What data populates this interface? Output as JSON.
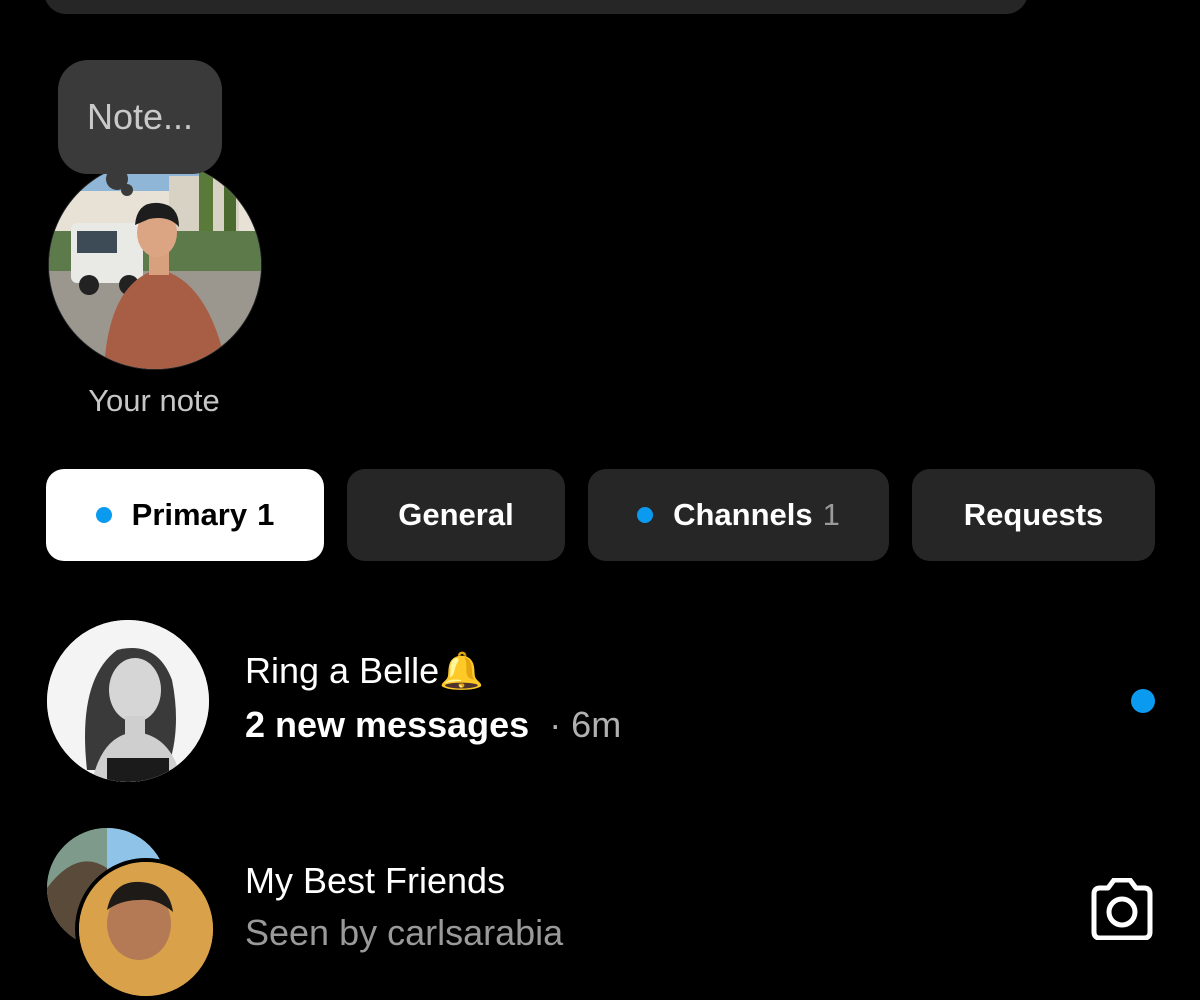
{
  "note": {
    "placeholder": "Note...",
    "caption": "Your note"
  },
  "tabs": [
    {
      "label": "Primary",
      "count": "1",
      "active": true,
      "unread_dot": true
    },
    {
      "label": "General",
      "count": "",
      "active": false,
      "unread_dot": false
    },
    {
      "label": "Channels",
      "count": "1",
      "active": false,
      "unread_dot": true
    },
    {
      "label": "Requests",
      "count": "",
      "active": false,
      "unread_dot": false
    }
  ],
  "conversations": [
    {
      "name": "Ring a Belle🔔",
      "preview": "2 new messages",
      "time": "· 6m",
      "unread": true,
      "icon": "unread-dot-icon"
    },
    {
      "name": "My Best Friends",
      "preview": "Seen by carlsarabia",
      "time": "",
      "unread": false,
      "icon": "camera-icon"
    }
  ],
  "colors": {
    "accent": "#0a9bf0",
    "background": "#000000",
    "chip": "#262626"
  }
}
